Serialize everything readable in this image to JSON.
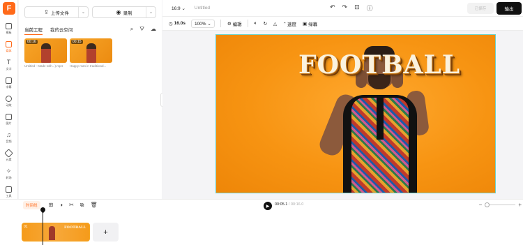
{
  "app": {
    "logo_letter": "F",
    "accent": "#ff6a1a"
  },
  "rail": [
    {
      "label": "模板",
      "icon": "template-icon"
    },
    {
      "label": "媒体",
      "icon": "media-icon"
    },
    {
      "label": "文字",
      "icon": "text-icon"
    },
    {
      "label": "字幕",
      "icon": "subtitle-icon"
    },
    {
      "label": "动效",
      "icon": "effects-icon"
    },
    {
      "label": "图片",
      "icon": "image-icon"
    },
    {
      "label": "音频",
      "icon": "audio-icon"
    },
    {
      "label": "元素",
      "icon": "elements-icon"
    },
    {
      "label": "转场",
      "icon": "transition-icon"
    },
    {
      "label": "工具",
      "icon": "tools-icon"
    }
  ],
  "panel": {
    "upload_label": "上传文件",
    "record_label": "录制",
    "tabs": [
      "当前工程",
      "我的云空间"
    ],
    "media": [
      {
        "duration": "00:16",
        "name": "Untitled - Made with...).mp4"
      },
      {
        "duration": "00:15",
        "name": "Happy man in traditional..."
      }
    ]
  },
  "topbar": {
    "ratio": "16:9",
    "title": "Untitled",
    "saved_label": "已保存",
    "export_label": "输出"
  },
  "toolbar": {
    "duration": "16.0s",
    "zoom": "100%",
    "edit_label": "编辑",
    "speed_label": "速度",
    "matte_label": "绿幕"
  },
  "canvas": {
    "overlay_text": "FOOTBALL"
  },
  "timeline": {
    "badge": "时间线",
    "current_time": "00:05.1",
    "total_time": "/ 00:16.0",
    "clip_number": "01",
    "clip_overlay": "FOOTBALL",
    "add_label": "+"
  }
}
